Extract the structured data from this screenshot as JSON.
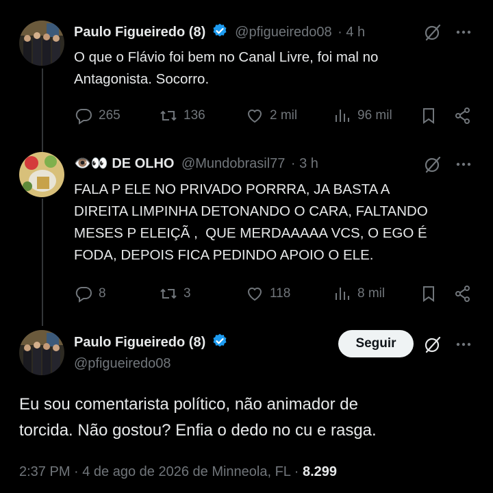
{
  "tweet1": {
    "name": "Paulo Figueiredo (8)",
    "handle": "@pfigueiredo08",
    "time": "· 4 h",
    "text_line1": "O que o Flávio foi bem no Canal Livre, foi mal no",
    "text_line2": "Antagonista. Socorro.",
    "replies": "265",
    "reposts": "136",
    "likes": "2 mil",
    "views": "96 mil"
  },
  "tweet2": {
    "name": "👁️👀 DE OLHO",
    "handle": "@Mundobrasil77",
    "time": "· 3 h",
    "text_line1": "FALA P ELE NO PRIVADO PORRRA, JA BASTA A",
    "text_line2": "DIREITA LIMPINHA DETONANDO O CARA, FALTANDO",
    "text_line3": "MESES P ELEIÇÃ ,  QUE MERDAAAAA VCS, O EGO É",
    "text_line4": "FODA, DEPOIS FICA PEDINDO APOIO O ELE.",
    "replies": "8",
    "reposts": "3",
    "likes": "118",
    "views": "8 mil"
  },
  "main_tweet": {
    "name": "Paulo Figueiredo (8)",
    "handle": "@pfigueiredo08",
    "follow_label": "Seguir",
    "text_line1": "Eu sou comentarista político, não animador de",
    "text_line2": "torcida. Não gostou? Enfia o dedo no cu e rasga.",
    "meta_text": "2:37 PM · 4 de ago de 2026 de Minneola, FL ·",
    "views_count": "8.299"
  },
  "colors": {
    "background": "#000000",
    "text": "#e7e9ea",
    "muted": "#71767b",
    "verified": "#1d9bf0",
    "thread_line": "#333639"
  },
  "icons": [
    "verified-badge-icon",
    "reply-icon",
    "repost-icon",
    "like-icon",
    "views-icon",
    "bookmark-icon",
    "share-icon",
    "grok-icon",
    "more-icon"
  ]
}
